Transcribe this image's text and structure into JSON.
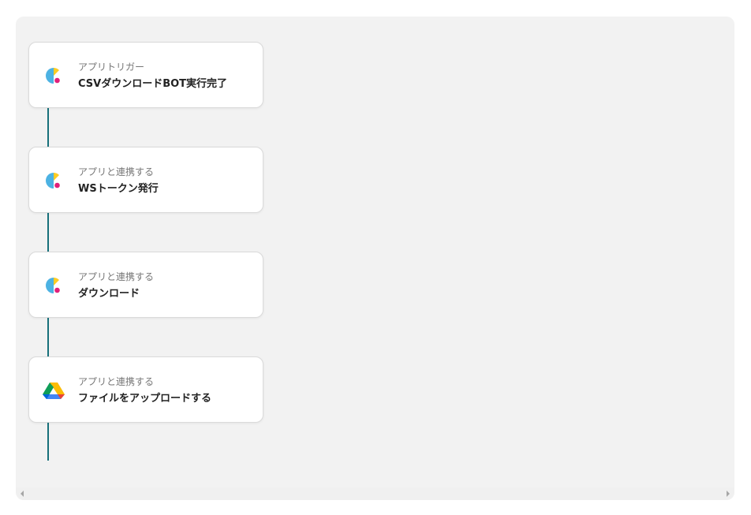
{
  "flow": {
    "steps": [
      {
        "subtitle": "アプリトリガー",
        "title": "CSVダウンロードBOT実行完了",
        "icon": "app-c-icon"
      },
      {
        "subtitle": "アプリと連携する",
        "title": "WSトークン発行",
        "icon": "app-c-icon"
      },
      {
        "subtitle": "アプリと連携する",
        "title": "ダウンロード",
        "icon": "app-c-icon"
      },
      {
        "subtitle": "アプリと連携する",
        "title": "ファイルをアップロードする",
        "icon": "google-drive-icon"
      }
    ]
  },
  "colors": {
    "canvas_bg": "#f2f2f2",
    "connector": "#17707a",
    "card_bg": "#ffffff"
  }
}
